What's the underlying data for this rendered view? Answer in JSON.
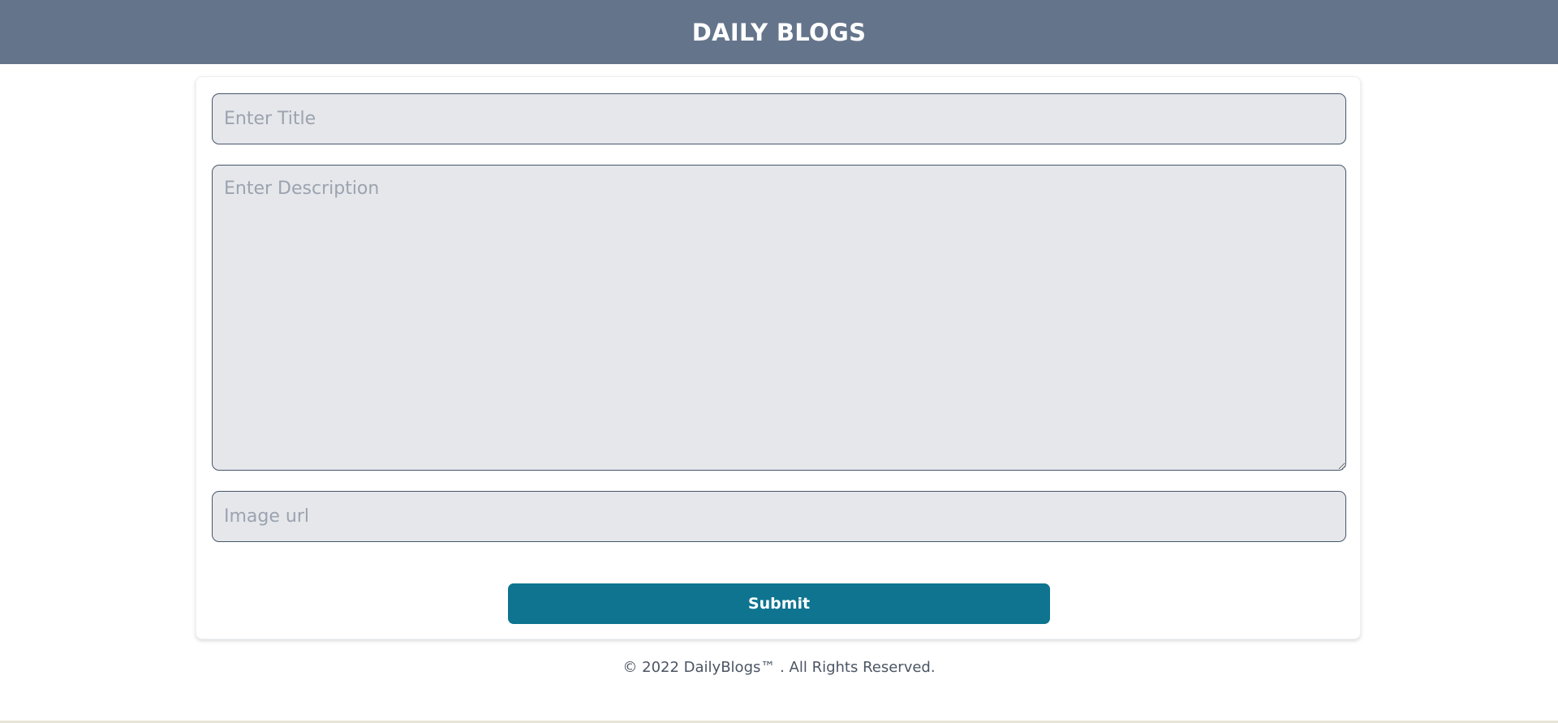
{
  "header": {
    "title": "DAILY BLOGS"
  },
  "form": {
    "title_placeholder": "Enter Title",
    "title_value": "",
    "description_placeholder": "Enter Description",
    "description_value": "",
    "image_placeholder": "Image url",
    "image_value": "",
    "submit_label": "Submit"
  },
  "footer": {
    "text": "© 2022 DailyBlogs™ . All Rights Reserved."
  },
  "colors": {
    "header_bg": "#64748b",
    "button_bg": "#0e7490",
    "field_bg": "#e5e7eb"
  }
}
